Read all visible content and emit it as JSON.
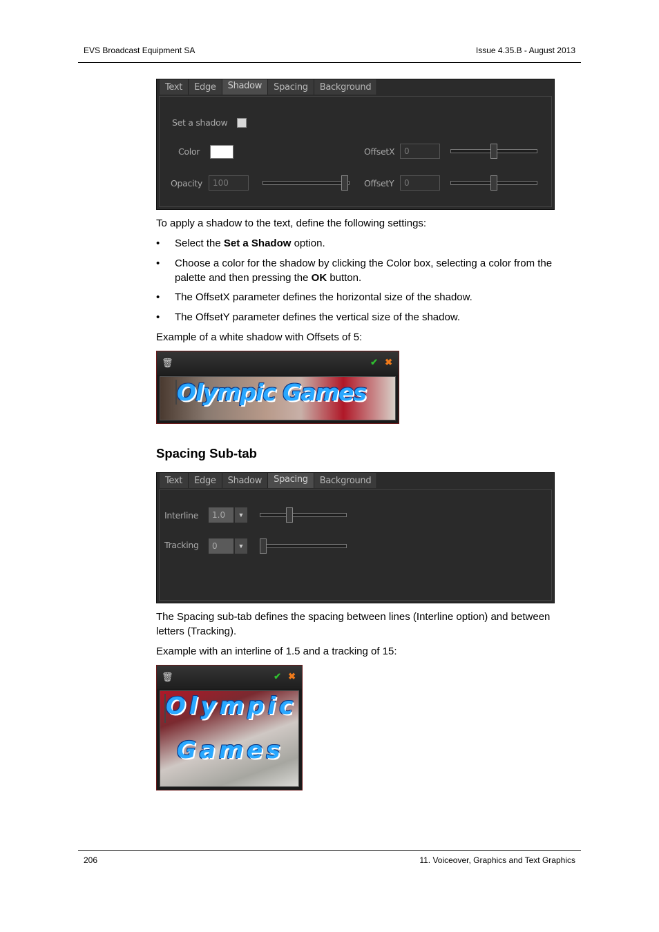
{
  "header": {
    "left": "EVS Broadcast Equipment SA",
    "right": "Issue 4.35.B - August 2013"
  },
  "shadow_panel": {
    "tabs": [
      "Text",
      "Edge",
      "Shadow",
      "Spacing",
      "Background"
    ],
    "active_tab": "Shadow",
    "set_shadow_label": "Set a shadow",
    "set_shadow_checked": false,
    "color_label": "Color",
    "color_value": "#ffffff",
    "opacity_label": "Opacity",
    "opacity_value": "100",
    "offsetx_label": "OffsetX",
    "offsetx_value": "0",
    "offsety_label": "OffsetY",
    "offsety_value": "0"
  },
  "body": {
    "intro": "To apply a shadow to the text, define the following settings:",
    "bullet_char": "•",
    "b1_pre": "Select the ",
    "b1_bold": "Set a Shadow",
    "b1_post": " option.",
    "b2_pre": "Choose a color for the shadow by clicking the Color box, selecting a color from the palette and then pressing the ",
    "b2_bold": "OK",
    "b2_post": " button.",
    "b3": "The OffsetX parameter defines the horizontal size of the shadow.",
    "b4": "The OffsetY parameter defines the vertical size of the shadow.",
    "example1": "Example of a white shadow with Offsets of 5:",
    "heading": "Spacing Sub-tab",
    "spacing_desc": "The Spacing sub-tab defines the spacing between lines (Interline option) and between letters (Tracking).",
    "example2": "Example with an interline of 1.5 and a tracking of 15:"
  },
  "preview1": {
    "text": "Olympic Games"
  },
  "spacing_panel": {
    "tabs": [
      "Text",
      "Edge",
      "Shadow",
      "Spacing",
      "Background"
    ],
    "active_tab": "Spacing",
    "interline_label": "Interline",
    "interline_value": "1.0",
    "tracking_label": "Tracking",
    "tracking_value": "0"
  },
  "preview2": {
    "line1": "Olympic",
    "line2": "Games"
  },
  "footer": {
    "left": "206",
    "right": "11. Voiceover, Graphics and Text Graphics"
  },
  "icons": {
    "trash": "trash-icon",
    "ok": "check-icon",
    "cancel": "close-icon",
    "dropdown": "chevron-down-icon"
  },
  "colors": {
    "ok": "#2fbf2f",
    "cancel": "#f07a1a",
    "text_fill": "#2aa8ff"
  }
}
